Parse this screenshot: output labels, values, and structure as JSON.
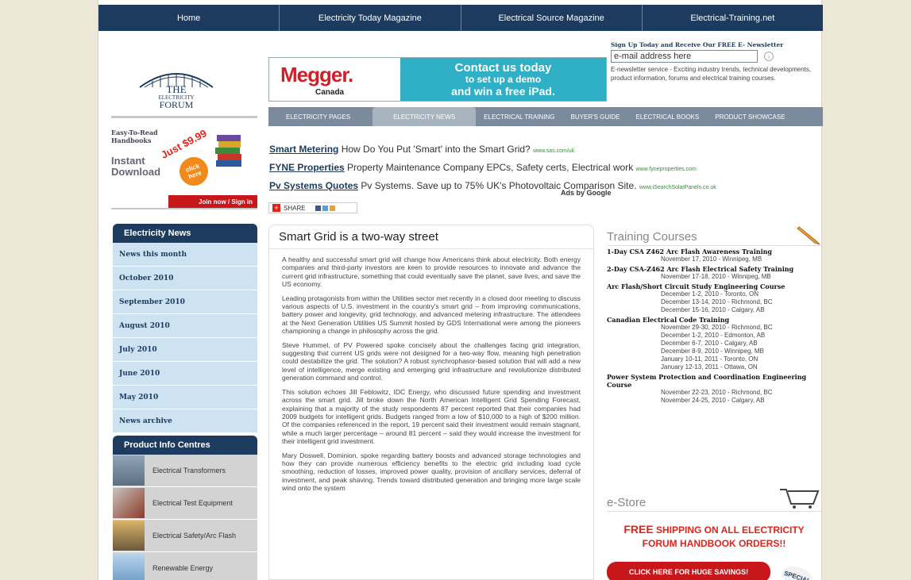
{
  "topnav": [
    "Home",
    "Electricity Today Magazine",
    "Electrical Source Magazine",
    "Electrical-Training.net"
  ],
  "logo": {
    "line1": "THE",
    "line2": "ELECTRICITY",
    "line3": "FORUM"
  },
  "newsletter": {
    "heading": "Sign Up Today and Receive Our FREE E- Newsletter",
    "email_value": "e-mail address here",
    "description": "E-newsletter service - Exciting industry trends, technical developments, product information, forums and electrical training courses."
  },
  "banner": {
    "brand": "Megger.",
    "brand_sub": "Canada",
    "line1": "Contact us today",
    "line2": "to set up a demo",
    "line3": "and win a free iPad."
  },
  "handbook": {
    "line1": "Easy-To-Read",
    "line2": "Handbooks",
    "line3": "Instant",
    "line4": "Download",
    "price": "Just $9.99",
    "click": "click here",
    "join": "Join now / Sign in"
  },
  "subnav": [
    "ELECTRICITY PAGES",
    "ELECTRICITY NEWS",
    "ELECTRICAL TRAINING",
    "BUYER'S GUIDE",
    "ELECTRICAL BOOKS",
    "PRODUCT SHOWCASE"
  ],
  "ads": [
    {
      "title": "Smart Metering",
      "text": "How Do You Put 'Smart' into the Smart Grid?",
      "url": "www.sas.com/uk"
    },
    {
      "title": "FYNE Properties",
      "text": "Property Maintenance Company EPCs, Safety certs, Electrical work",
      "url": "www.fyneproperties.com"
    },
    {
      "title": "Pv Systems Quotes",
      "text": "Pv Systems. Save up to 75% UK's Photovoltaic Comparison Site.",
      "url": "www.iSearchSolarPanels.co.uk"
    }
  ],
  "ads_by": "Ads by Google",
  "share": "SHARE",
  "news_sidebar": {
    "heading": "Electricity News",
    "items": [
      "News this month",
      "October 2010",
      "September 2010",
      "August 2010",
      "July 2010",
      "June 2010",
      "May 2010",
      "News archive"
    ]
  },
  "product_sidebar": {
    "heading": "Product Info Centres",
    "items": [
      "Electrical Transformers",
      "Electrical Test Equipment",
      "Electrical Safety/Arc Flash",
      "Renewable Energy"
    ]
  },
  "article": {
    "title": "Smart Grid is a two-way street",
    "paragraphs": [
      "A healthy and successful smart grid will change how Americans think about electricity. Both energy companies and third-party investors are keen to provide resources to innovate and advance the current grid infrastructure, something that could eventually save the planet, save lives, and save the US economy.",
      "Leading protagonists from within the Utilities sector met recently in a closed door meeting to discuss various aspects of U.S. investment in the country's smart grid – from improving communications, battery power and longevity, grid technology, and advanced metering infrastructure. The attendees at the Next Generation Utilities US Summit hosted by GDS International were among the pioneers championing a change in philosophy across the grid.",
      "Steve Hummel, of PV Powered spoke concisely about the challenges facing grid integration, suggesting that current US grids were not designed for a two-way flow, meaning high penetration could destabilize the grid. The solution? A robust synchrophasor-based solution that will add a new level of intelligence, merge existing and emerging grid infrastructure and revolutionize distributed generation command and control.",
      "This solution echoes Jill Feblowitz, IDC Energy, who discussed future spending and investment across the smart grid. Jill broke down the North American Intelligent Grid Spending Forecast, explaining that a majority of the study respondents 87 percent reported that their companies had 2009 budgets for intelligent grids. Budgets ranged from a low of $10,000 to a high of $200 million. Of the companies referenced in the report, 19 percent said their investment would remain stagnant, while a much larger percentage – around 81 percent – said they would increase the investment for their intelligent grid investment.",
      "Mary Doswell, Dominion, spoke regarding battery boosts and advanced storage technologies and how they can provide numerous efficiency benefits to the electric grid including load cycle smoothing, reduction of losses, improved power quality, provision of ancillary services, deferral of investment, and peak shaving. Trends toward distributed generation and bringing more large scale wind onto the system"
    ]
  },
  "training": {
    "heading": "Training Courses",
    "courses": [
      {
        "title": "1-Day CSA Z462 Arc Flash Awareness Training",
        "sessions": [
          "November 17, 2010 - Winnipeg, MB"
        ]
      },
      {
        "title": "2-Day CSA-Z462 Arc Flash Electrical Safety Training",
        "sessions": [
          "November 17-18, 2010 - Winnipeg, MB"
        ]
      },
      {
        "title": "Arc Flash/Short Circuit Study Engineering Course",
        "sessions": [
          "December 1-2, 2010 - Toronto, ON",
          "December 13-14, 2010 - Richmond, BC",
          "December 15-16, 2010 - Calgary, AB"
        ]
      },
      {
        "title": "Canadian Electrical Code Training",
        "sessions": [
          "November 29-30, 2010 - Richmond, BC",
          "December 1-2, 2010 - Edmonton, AB",
          "December 6-7, 2010 - Calgary, AB",
          "December 8-9, 2010 - Winnipeg, MB",
          "January 10-11, 2011 - Toronto, ON",
          "January 12-13, 2011 - Ottawa, ON"
        ]
      },
      {
        "title": "Power System Protection and Coordination Engineering Course",
        "sessions": [
          "November 22-23, 2010 - Richmond, BC",
          "November 24-25, 2010 - Calgary, AB"
        ]
      }
    ]
  },
  "estore": {
    "heading": "e-Store",
    "free": "FREE",
    "free_text": "SHIPPING ON ALL ELECTRICITY FORUM HANDBOOK ORDERS!!",
    "savings": "CLICK HERE FOR HUGE SAVINGS!",
    "special": "SPECIAL"
  },
  "colors": {
    "navy": "#1d3b5e",
    "teal": "#2fb0c6",
    "red": "#e2231a",
    "sidebar_item": "#cde3f1"
  }
}
